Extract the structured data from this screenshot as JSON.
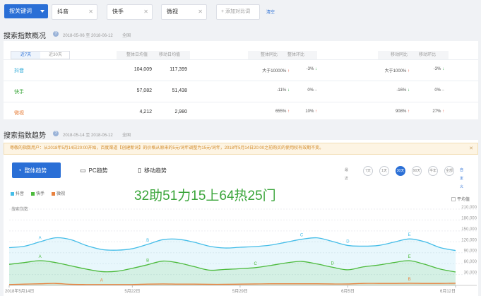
{
  "topbar": {
    "mode": "按关键词",
    "keywords": [
      "抖音",
      "快手",
      "微视"
    ],
    "add_label": "+ 添加对比词",
    "clear_label": "清空"
  },
  "overview": {
    "title": "搜索指数概况",
    "date": "2018-05-06 至 2018-06-12",
    "scope": "全国",
    "tabs": [
      "近7天",
      "近30天"
    ],
    "group1": [
      "整体日均值",
      "移动日均值"
    ],
    "group2": [
      "整体同比",
      "整体环比"
    ],
    "group3": [
      "移动同比",
      "移动环比"
    ],
    "rows": [
      {
        "name": "抖音",
        "color": "#23a6d6",
        "avg": "104,009",
        "mavg": "117,399",
        "yoy": "大于10000%",
        "yoy_dir": "up",
        "mom": "-3%",
        "mom_dir": "down",
        "myoy": "大于1000%",
        "myoy_dir": "up",
        "mmom": "-3%",
        "mmom_dir": "down"
      },
      {
        "name": "快手",
        "color": "#3aa53a",
        "avg": "57,082",
        "mavg": "51,438",
        "yoy": "-11%",
        "yoy_dir": "down",
        "mom": "0%",
        "mom_dir": "flat",
        "myoy": "-16%",
        "myoy_dir": "down",
        "mmom": "0%",
        "mmom_dir": "flat"
      },
      {
        "name": "微视",
        "color": "#e8823f",
        "avg": "4,212",
        "mavg": "2,980",
        "yoy": "655%",
        "yoy_dir": "up",
        "mom": "10%",
        "mom_dir": "up",
        "myoy": "908%",
        "myoy_dir": "up",
        "mmom": "27%",
        "mmom_dir": "up"
      }
    ]
  },
  "trend": {
    "title": "搜索指数趋势",
    "date": "2018-05-14 至 2018-06-12",
    "scope": "全国",
    "notice": "尊敬的指数用户：从2018年5月14日20:00开始，百度渠道【创建新词】的价格从原来的5元/词年调整为15元/词年，2018年5月14日20:00之前购买的使用权有效期不变。",
    "tabs": [
      {
        "label": "整体趋势",
        "icon": "pie-icon",
        "active": true
      },
      {
        "label": "PC趋势",
        "icon": "monitor-icon",
        "active": false
      },
      {
        "label": "移动趋势",
        "icon": "phone-icon",
        "active": false
      }
    ],
    "periods": [
      "最近",
      "7天",
      "1天",
      "30天",
      "90天",
      "半年",
      "全部",
      "自定义"
    ],
    "active_period": "30天",
    "avg_label": "平均值",
    "y_title": "搜索指数",
    "overlay_text": "32助51力15上64热25门"
  },
  "chart_data": {
    "type": "area",
    "x": [
      "2018-05-14",
      "2018-05-15",
      "2018-05-16",
      "2018-05-17",
      "2018-05-18",
      "2018-05-19",
      "2018-05-20",
      "2018-05-21",
      "2018-05-22",
      "2018-05-23",
      "2018-05-24",
      "2018-05-25",
      "2018-05-26",
      "2018-05-27",
      "2018-05-28",
      "2018-05-29",
      "2018-05-30",
      "2018-05-31",
      "2018-06-01",
      "2018-06-02",
      "2018-06-03",
      "2018-06-04",
      "2018-06-05",
      "2018-06-06",
      "2018-06-07",
      "2018-06-08",
      "2018-06-09",
      "2018-06-10",
      "2018-06-11",
      "2018-06-12"
    ],
    "x_tick_labels": [
      "2018年5月14日",
      "5月22日",
      "5月29日",
      "6月5日",
      "6月12日"
    ],
    "x_tick_index": [
      0,
      8,
      15,
      22,
      29
    ],
    "ylim": [
      0,
      210000
    ],
    "y_ticks": [
      30000,
      60000,
      90000,
      120000,
      150000,
      180000,
      210000
    ],
    "y_tick_labels": [
      "30,000",
      "60,000",
      "90,000",
      "120,000",
      "150,000",
      "180,000",
      "210,000"
    ],
    "series": [
      {
        "name": "抖音",
        "color": "#45bde8",
        "values": [
          104000,
          108000,
          120000,
          131000,
          126000,
          110000,
          99000,
          97000,
          101000,
          113000,
          126000,
          127000,
          119000,
          108000,
          103000,
          105000,
          107000,
          111000,
          119000,
          127000,
          131000,
          121000,
          110000,
          108000,
          110000,
          119000,
          128000,
          120000,
          104000,
          96000
        ],
        "markers": {
          "2": "A",
          "9": "B",
          "19": "C",
          "22": "D",
          "26": "E"
        }
      },
      {
        "name": "快手",
        "color": "#4dbb3d",
        "values": [
          58000,
          63000,
          68000,
          63000,
          54000,
          45000,
          38000,
          39000,
          47000,
          57000,
          67000,
          62000,
          52000,
          42000,
          44000,
          46000,
          49000,
          55000,
          62000,
          66000,
          59000,
          50000,
          43000,
          51000,
          56000,
          63000,
          68000,
          58000,
          45000,
          37000
        ],
        "markers": {
          "2": "A",
          "9": "B",
          "16": "C",
          "21": "D",
          "26": "E"
        }
      },
      {
        "name": "微视",
        "color": "#e8823f",
        "values": [
          2500,
          3500,
          4500,
          5500,
          3000,
          2500,
          2500,
          2500,
          2500,
          3500,
          4000,
          3500,
          3500,
          3000,
          3000,
          3500,
          4000,
          4500,
          4500,
          4500,
          4500,
          4000,
          4000,
          5500,
          5500,
          5500,
          6000,
          5500,
          5500,
          6000
        ],
        "markers": {
          "6": "A",
          "26": "B"
        }
      }
    ]
  }
}
